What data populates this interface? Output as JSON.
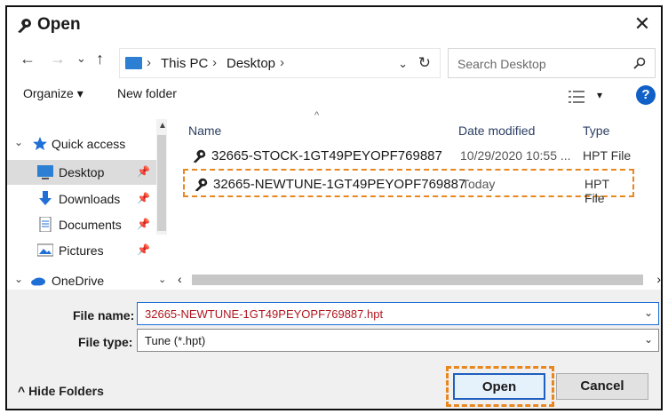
{
  "window": {
    "title": "Open",
    "close_symbol": "✕"
  },
  "address_bar": {
    "back_symbol": "←",
    "forward_symbol": "→",
    "recent_symbol": "⌄",
    "up_symbol": "↑",
    "crumbs": [
      "This PC",
      "Desktop"
    ],
    "separator": "›",
    "dropdown_symbol": "⌄",
    "refresh_symbol": "↻"
  },
  "search": {
    "placeholder": "Search Desktop"
  },
  "toolbar": {
    "organize_label": "Organize ▾",
    "new_folder_label": "New folder",
    "view_dropdown_symbol": "▾",
    "help_label": "?"
  },
  "nav_pane": {
    "items": [
      {
        "label": "Quick access",
        "caret": "⌄",
        "pinned": false
      },
      {
        "label": "Desktop",
        "pinned": true
      },
      {
        "label": "Downloads",
        "pinned": true
      },
      {
        "label": "Documents",
        "pinned": true
      },
      {
        "label": "Pictures",
        "pinned": true
      }
    ],
    "pin_symbol": "📌",
    "onedrive": {
      "label": "OneDrive",
      "caret": "⌄"
    }
  },
  "file_list": {
    "columns": [
      "Name",
      "Date modified",
      "Type"
    ],
    "sort_indicator": "^",
    "rows": [
      {
        "name": "32665-STOCK-1GT49PEYOPF769887",
        "date": "10/29/2020 10:55 ...",
        "type": "HPT File"
      },
      {
        "name": "32665-NEWTUNE-1GT49PEYOPF769887",
        "date": "Today",
        "type": "HPT File"
      }
    ]
  },
  "bottom": {
    "file_name_label": "File name:",
    "file_name_value": "32665-NEWTUNE-1GT49PEYOPF769887.hpt",
    "file_type_label": "File type:",
    "file_type_value": "Tune (*.hpt)",
    "hide_folders_label": "^ Hide Folders",
    "open_label": "Open",
    "cancel_label": "Cancel",
    "dropdown_symbol": "⌄"
  },
  "colors": {
    "highlight": "#e8871e",
    "accent": "#1f6fd6",
    "filename_text": "#b0171f"
  }
}
